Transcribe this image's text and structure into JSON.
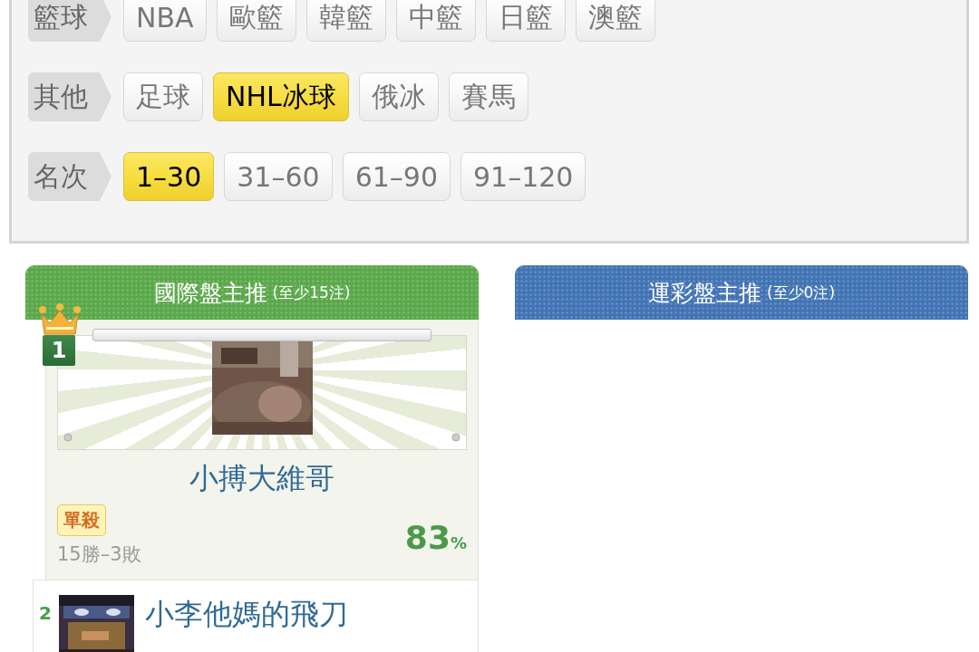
{
  "filters": [
    {
      "label": "籃球",
      "options": [
        {
          "label": "NBA",
          "selected": false
        },
        {
          "label": "歐籃",
          "selected": false
        },
        {
          "label": "韓籃",
          "selected": false
        },
        {
          "label": "中籃",
          "selected": false
        },
        {
          "label": "日籃",
          "selected": false
        },
        {
          "label": "澳籃",
          "selected": false
        }
      ]
    },
    {
      "label": "其他",
      "options": [
        {
          "label": "足球",
          "selected": false
        },
        {
          "label": "NHL冰球",
          "selected": true
        },
        {
          "label": "俄冰",
          "selected": false
        },
        {
          "label": "賽馬",
          "selected": false
        }
      ]
    },
    {
      "label": "名次",
      "options": [
        {
          "label": "1–30",
          "selected": true
        },
        {
          "label": "31–60",
          "selected": false
        },
        {
          "label": "61–90",
          "selected": false
        },
        {
          "label": "91–120",
          "selected": false
        }
      ]
    }
  ],
  "panels": [
    {
      "title": "國際盤主推",
      "note": "(至少15注)",
      "color": "#5aa84a",
      "entries": [
        {
          "kind": "featured",
          "rank": "1",
          "name": "小搏大維哥",
          "tag": "單殺",
          "record": "15勝–3敗",
          "rate": "83",
          "rate_unit": "%"
        },
        {
          "kind": "compact",
          "rank": "2",
          "name": "小李他媽的飛刀"
        }
      ]
    },
    {
      "title": "運彩盤主推",
      "note": "(至少0注)",
      "color": "#4274b4"
    }
  ]
}
